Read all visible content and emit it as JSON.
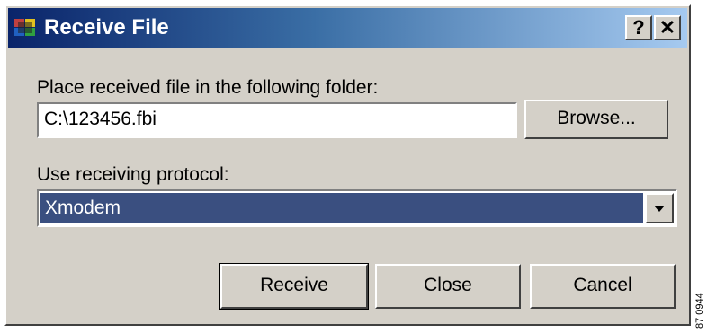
{
  "window": {
    "title": "Receive File",
    "help_label": "?",
    "close_label": "✕"
  },
  "folder": {
    "label": "Place received file in the following folder:",
    "value": "C:\\123456.fbi",
    "browse_label": "Browse..."
  },
  "protocol": {
    "label": "Use receiving protocol:",
    "selected": "Xmodem"
  },
  "buttons": {
    "receive": "Receive",
    "close": "Close",
    "cancel": "Cancel"
  },
  "edge_code": "87 0944",
  "colors": {
    "title_gradient_start": "#0a246a",
    "title_gradient_end": "#a6caf0",
    "dialog_face": "#d4d0c8",
    "selection": "#3a4f80"
  }
}
